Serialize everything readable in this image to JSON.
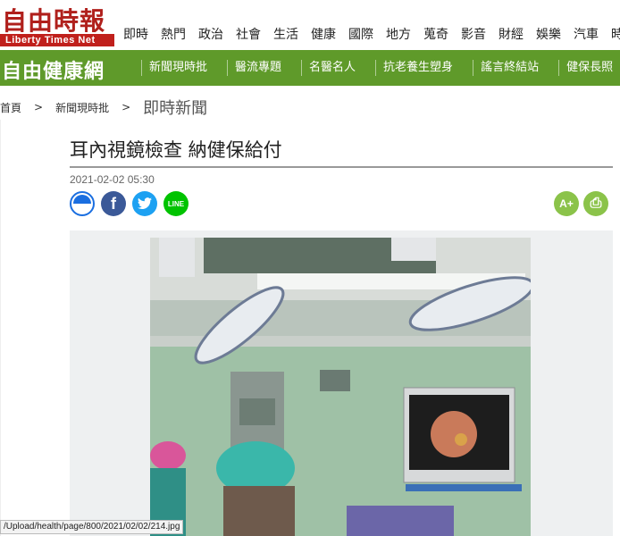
{
  "site": {
    "logo_cn": "自由時報",
    "logo_en": "Liberty Times Net",
    "nav": [
      "即時",
      "熱門",
      "政治",
      "社會",
      "生活",
      "健康",
      "國際",
      "地方",
      "蒐奇",
      "影音",
      "財經",
      "娛樂",
      "汽車",
      "時尚"
    ]
  },
  "channel": {
    "logo": "自由健康網",
    "nav": [
      "新聞現時批",
      "醫流專題",
      "名醫名人",
      "抗老養生塑身",
      "謠言終結站",
      "健保長照"
    ]
  },
  "breadcrumb": {
    "home": "首頁",
    "section": "新聞現時批",
    "current": "即時新聞",
    "separator": ">"
  },
  "article": {
    "title": "耳內視鏡檢查 納健保給付",
    "datetime": "2021-02-02 05:30"
  },
  "share": {
    "facebook_glyph": "f",
    "twitter_glyph": "t",
    "line_label": "LINE"
  },
  "tools": {
    "font_size_label": "A+",
    "print_glyph": "⎙"
  },
  "status_bar": {
    "url": "/Upload/health/page/800/2021/02/02/214.jpg"
  },
  "colors": {
    "brand_red": "#c0201c",
    "health_green": "#5f9a2a",
    "tool_green": "#8bc34a"
  }
}
